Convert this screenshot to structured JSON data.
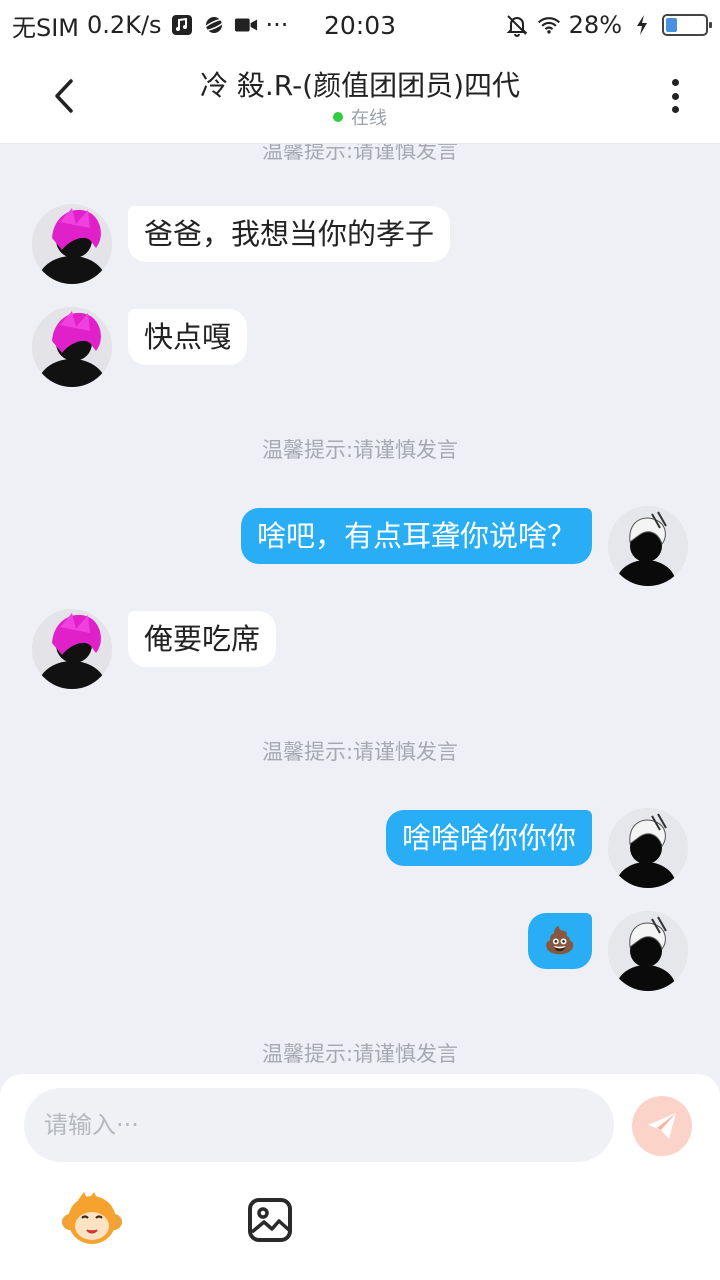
{
  "status_bar": {
    "carrier": "无SIM",
    "speed": "0.2K/s",
    "time": "20:03",
    "battery_percent": "28%",
    "battery_level": 0.28,
    "more_dots": "···"
  },
  "header": {
    "title": "冷 殺.R-(颜值团团员)四代",
    "status": "在线",
    "online_color": "#2ecc40"
  },
  "chat": {
    "notices": [
      "温馨提示:请谨慎发言",
      "温馨提示:请谨慎发言",
      "温馨提示:请谨慎发言",
      "温馨提示:请谨慎发言"
    ],
    "messages": [
      {
        "side": "in",
        "text": "爸爸，我想当你的孝子"
      },
      {
        "side": "in",
        "text": "快点嘎"
      },
      {
        "side": "out",
        "text": "啥吧，有点耳聋你说啥？"
      },
      {
        "side": "in",
        "text": "俺要吃席"
      },
      {
        "side": "out",
        "text": "啥啥啥你你你"
      },
      {
        "side": "out",
        "text": "💩"
      }
    ]
  },
  "composer": {
    "placeholder": "请输入···",
    "emoji_icon": "monkey-face-icon",
    "image_icon": "image-icon",
    "send_icon": "paper-plane-icon"
  },
  "colors": {
    "outgoing_bubble": "#29adf4",
    "incoming_bubble": "#ffffff",
    "background": "#eef0f5",
    "send_button": "#fbd3c8"
  }
}
